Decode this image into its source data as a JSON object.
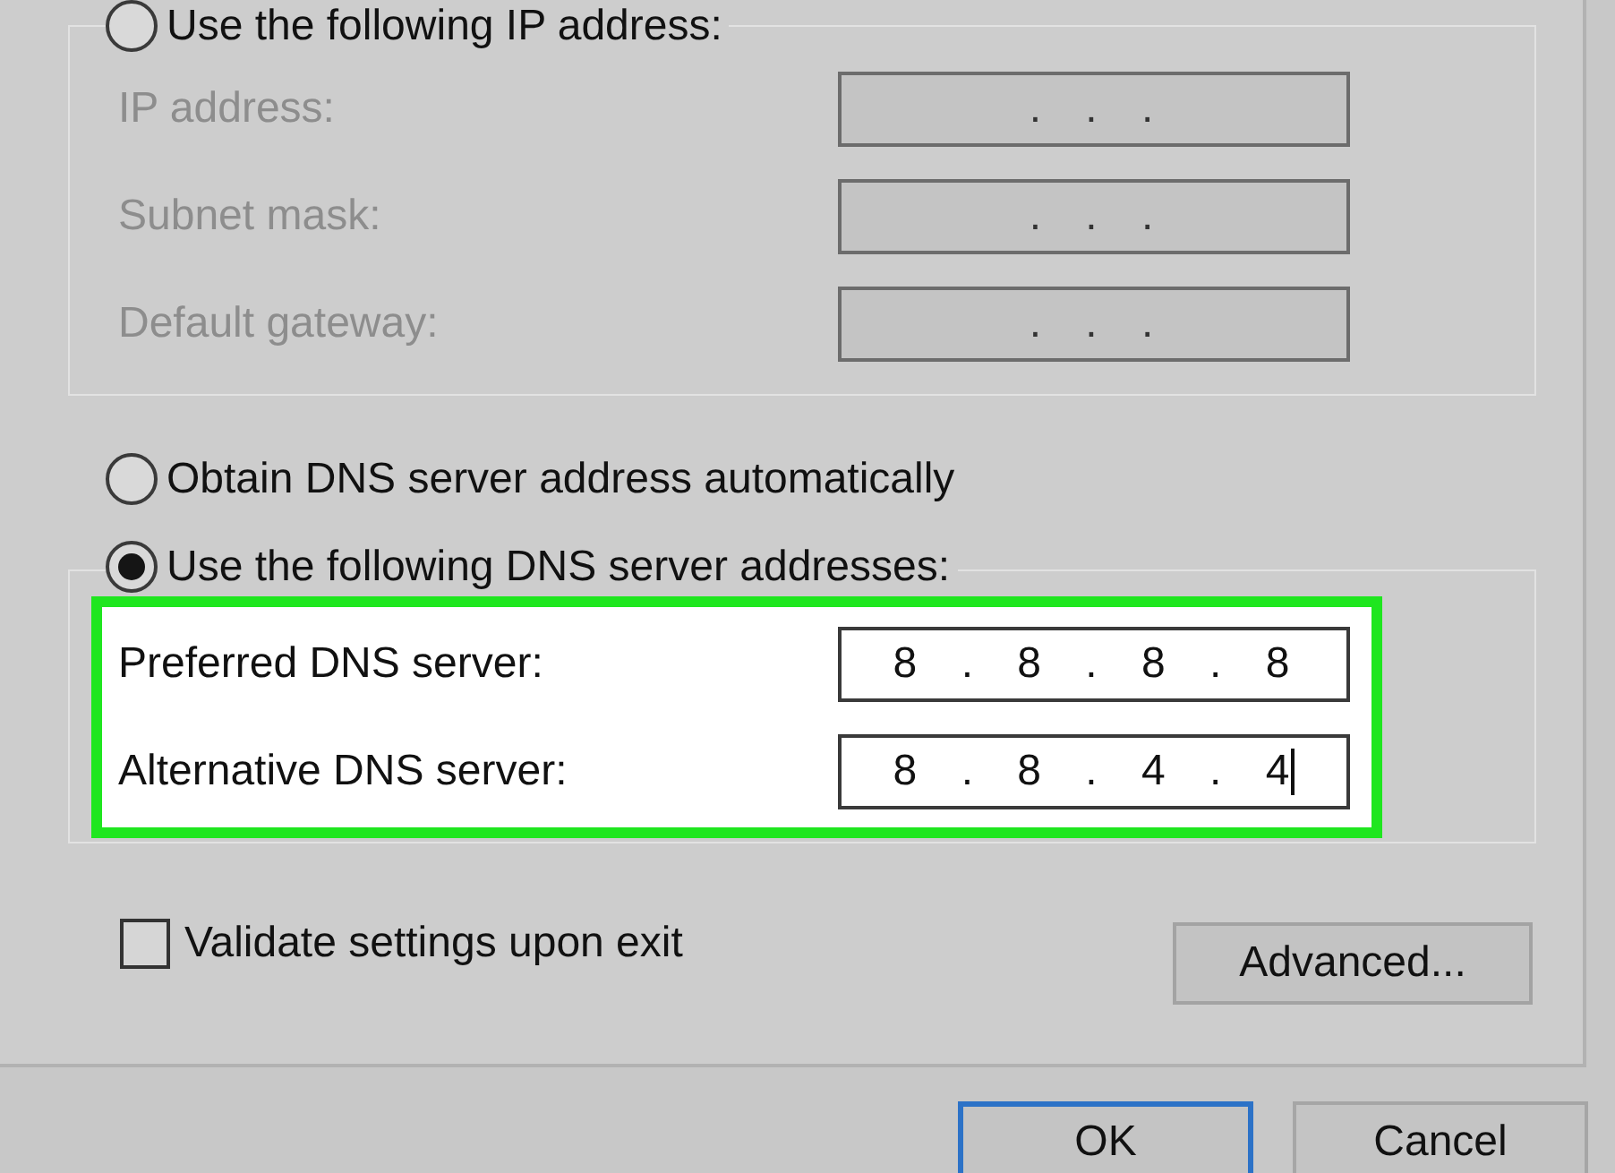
{
  "ip_group": {
    "option": {
      "label": "Use the following IP address:",
      "selected": false
    },
    "fields": [
      {
        "label": "IP address:",
        "value": ". . .",
        "disabled": true,
        "focused": false
      },
      {
        "label": "Subnet mask:",
        "value": ". . .",
        "disabled": true,
        "focused": false
      },
      {
        "label": "Default gateway:",
        "value": ". . .",
        "disabled": true,
        "focused": false
      }
    ]
  },
  "dns_auto_option": {
    "label": "Obtain DNS server address automatically",
    "selected": false
  },
  "dns_group": {
    "option": {
      "label": "Use the following DNS server addresses:",
      "selected": true
    },
    "highlighted": true,
    "fields": [
      {
        "label": "Preferred DNS server:",
        "value": "8 . 8 . 8 . 8",
        "disabled": false,
        "focused": false
      },
      {
        "label": "Alternative DNS server:",
        "value": "8 . 8 . 4 . 4",
        "disabled": false,
        "focused": true
      }
    ]
  },
  "validate_checkbox": {
    "label": "Validate settings upon exit",
    "checked": false
  },
  "advanced_button": {
    "label": "Advanced..."
  },
  "dialog_buttons": [
    {
      "label": "OK",
      "default": true
    },
    {
      "label": "Cancel",
      "default": false
    }
  ]
}
